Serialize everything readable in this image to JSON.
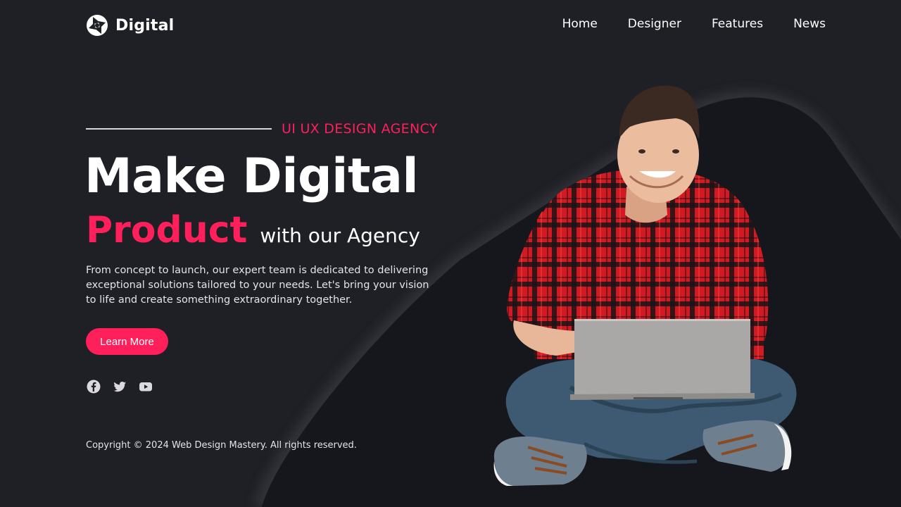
{
  "logo": {
    "text": "Digital",
    "icon": "aperture-icon"
  },
  "nav": {
    "items": [
      {
        "label": "Home"
      },
      {
        "label": "Designer"
      },
      {
        "label": "Features"
      },
      {
        "label": "News"
      }
    ]
  },
  "hero": {
    "eyebrow": "UI UX DESIGN AGENCY",
    "headline_line1": "Make Digital",
    "headline_accent": "Product",
    "headline_tail": "with our Agency",
    "description": "From concept to launch, our expert team is dedicated to delivering exceptional solutions tailored to your needs. Let's bring your vision to life and create something extraordinary together.",
    "cta_label": "Learn More"
  },
  "socials": [
    {
      "icon": "facebook-icon"
    },
    {
      "icon": "twitter-icon"
    },
    {
      "icon": "youtube-icon"
    }
  ],
  "footer": {
    "copyright": "Copyright © 2024 Web Design Mastery. All rights reserved."
  },
  "colors": {
    "background": "#1f2026",
    "shape": "#16171c",
    "accent": "#ff1f5a",
    "text": "#ffffff"
  },
  "image": {
    "subject": "smiling man in red plaid shirt sitting cross-legged with a laptop"
  }
}
